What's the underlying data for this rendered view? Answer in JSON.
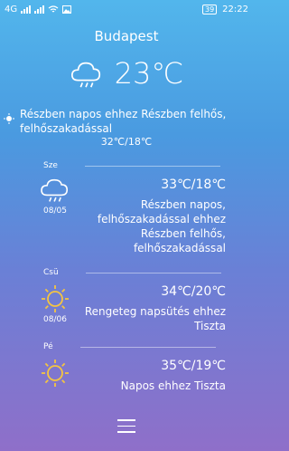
{
  "statusbar": {
    "network": "4G",
    "time": "22:22",
    "battery": "39"
  },
  "current": {
    "city": "Budapest",
    "temperature": "23℃",
    "icon": "cloud-rain-icon",
    "condition": "Részben napos ehhez Részben felhős, felhőszakadással",
    "range": "32℃/18℃"
  },
  "forecast": [
    {
      "day": "Sze",
      "date": "08/05",
      "icon": "cloud-rain-icon",
      "temp": "33℃/18℃",
      "desc": "Részben napos, felhőszakadással ehhez Részben felhős, felhőszakadással"
    },
    {
      "day": "Csü",
      "date": "08/06",
      "icon": "sun-icon",
      "temp": "34℃/20℃",
      "desc": "Rengeteg napsütés ehhez Tiszta"
    },
    {
      "day": "Pé",
      "date": "",
      "icon": "sun-icon",
      "temp": "35℃/19℃",
      "desc": "Napos ehhez Tiszta"
    }
  ]
}
